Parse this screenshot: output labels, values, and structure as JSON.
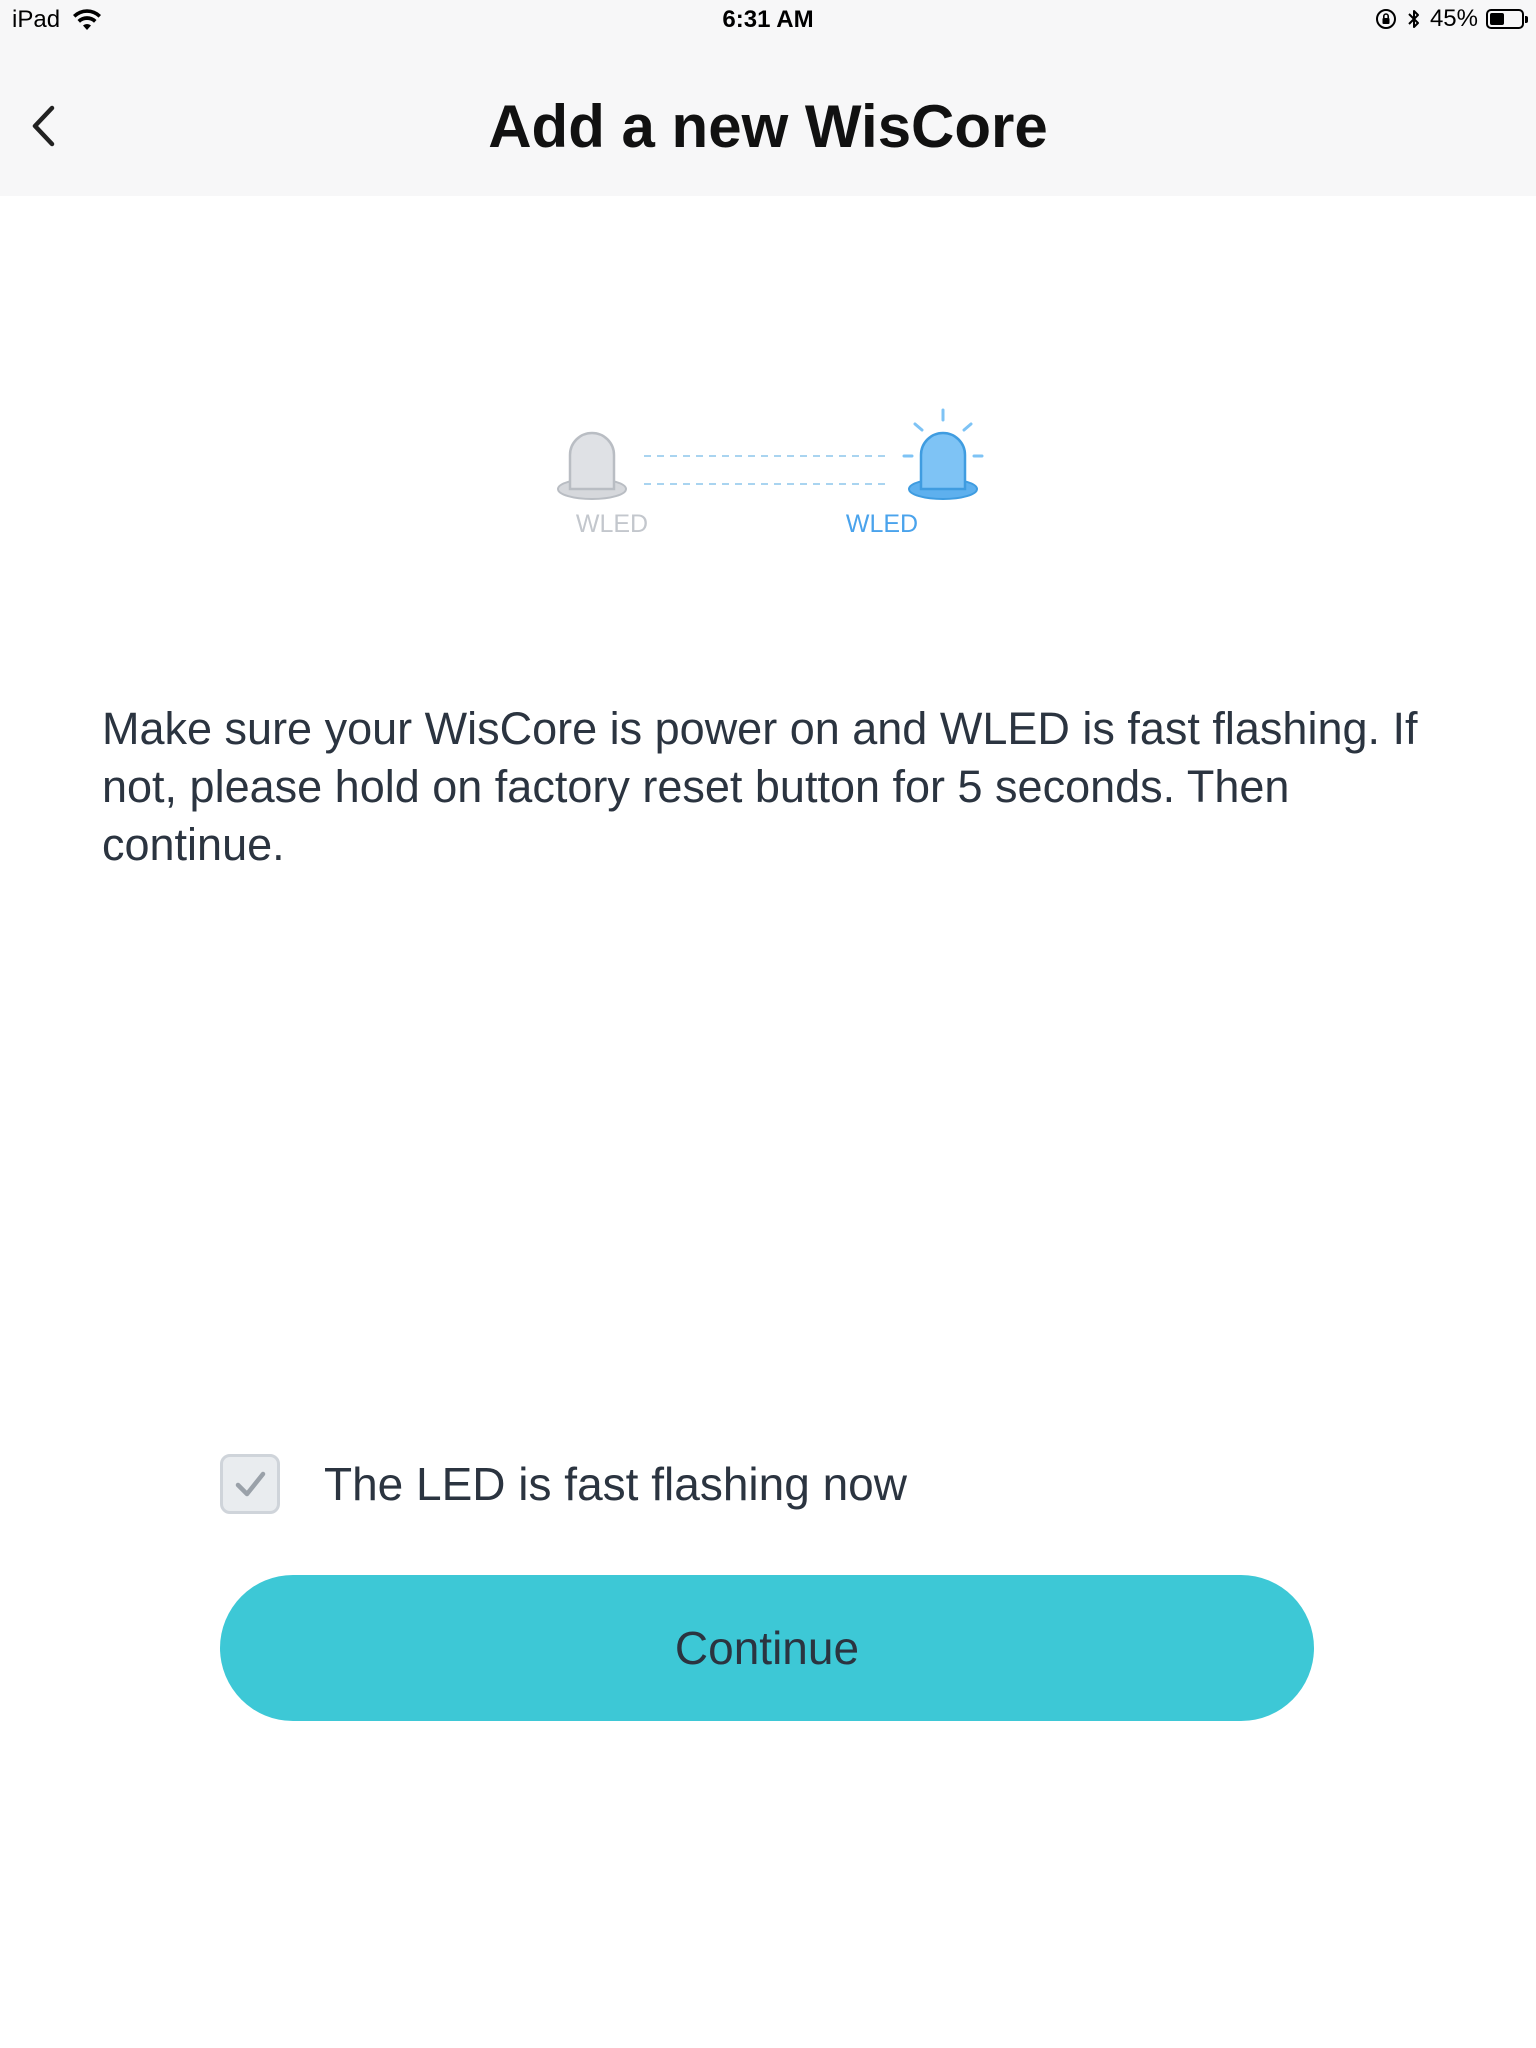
{
  "status_bar": {
    "carrier": "iPad",
    "time": "6:31 AM",
    "battery_percent": "45%",
    "battery_level": 0.45
  },
  "nav": {
    "title": "Add a new WisCore",
    "back_icon": "chevron-left-icon"
  },
  "illustration": {
    "led_off_label": "WLED",
    "led_on_label": "WLED",
    "colors": {
      "off": "#dfe1e5",
      "on": "#7ec3f5",
      "dash": "#a9d4f0"
    }
  },
  "instruction": "Make sure your WisCore is power on and WLED is fast flashing. If not, please hold on factory reset button for 5 seconds. Then continue.",
  "checkbox": {
    "label": "The LED is fast flashing now",
    "checked": true
  },
  "continue_button": {
    "label": "Continue",
    "color": "#3dc8d6"
  }
}
